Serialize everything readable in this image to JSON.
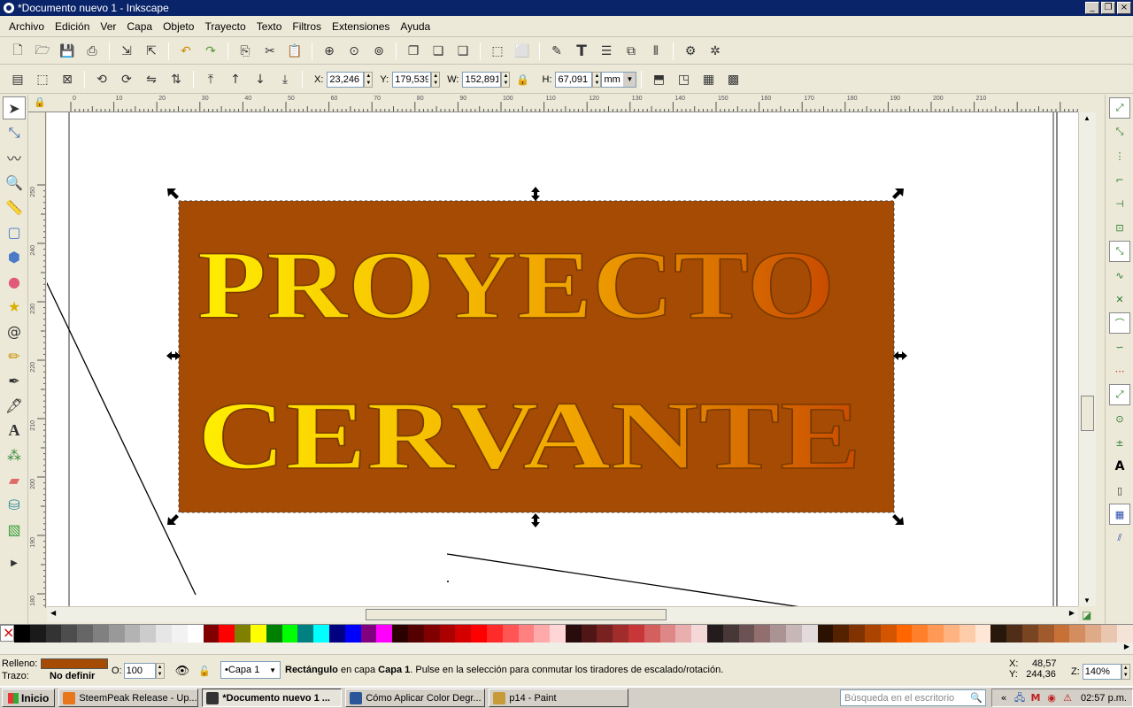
{
  "window": {
    "title": "*Documento nuevo 1 - Inkscape",
    "btn_min": "_",
    "btn_max": "❐",
    "btn_close": "×"
  },
  "menu": [
    "Archivo",
    "Edición",
    "Ver",
    "Capa",
    "Objeto",
    "Trayecto",
    "Texto",
    "Filtros",
    "Extensiones",
    "Ayuda"
  ],
  "toolbar1": [
    "new-icon",
    "open-icon",
    "save-icon",
    "print-icon",
    "import-icon",
    "export-icon",
    "undo-icon",
    "redo-icon",
    "copy-icon",
    "cut-icon",
    "paste-icon",
    "zoom-selection-icon",
    "zoom-drawing-icon",
    "zoom-page-icon",
    "duplicate-icon",
    "clone-icon",
    "unlink-clone-icon",
    "group-icon",
    "ungroup-icon",
    "fill-stroke-icon",
    "text-font-icon",
    "layers-icon",
    "xml-editor-icon",
    "align-icon",
    "preferences-icon",
    "document-properties-icon"
  ],
  "transform": {
    "x_label": "X:",
    "x_value": "23,246",
    "y_label": "Y:",
    "y_value": "179,539",
    "w_label": "W:",
    "w_value": "152,891",
    "h_label": "H:",
    "h_value": "67,091",
    "unit": "mm"
  },
  "ruler": {
    "top_labels": [
      "0",
      "10",
      "20",
      "30",
      "40",
      "50",
      "60",
      "70",
      "80",
      "90",
      "100",
      "110",
      "120",
      "130",
      "140",
      "150",
      "160",
      "170",
      "180",
      "190",
      "200",
      "210"
    ],
    "left_labels": [
      "250",
      "240",
      "230",
      "220",
      "210",
      "200",
      "190",
      "180"
    ]
  },
  "artwork": {
    "line1": "PROYECTO",
    "line2": "CERVANTE",
    "rect_color": "#a64b04",
    "text_gradient_start": "#ffef00",
    "text_gradient_end": "#c84a00"
  },
  "tools": [
    "selector-icon",
    "node-icon",
    "tweak-icon",
    "zoom-icon",
    "measure-icon",
    "rectangle-icon",
    "3d-box-icon",
    "ellipse-icon",
    "star-icon",
    "spiral-icon",
    "pencil-icon",
    "pen-icon",
    "calligraphy-icon",
    "text-icon",
    "spray-icon",
    "eraser-icon",
    "paint-bucket-icon",
    "gradient-icon"
  ],
  "snap_tools": [
    "snap-toggle-icon",
    "snap-bbox-icon",
    "snap-bbox-edge-icon",
    "snap-bbox-corner-icon",
    "snap-bbox-midpoint-icon",
    "snap-bbox-center-icon",
    "snap-nodes-icon",
    "snap-path-icon",
    "snap-intersection-icon",
    "snap-cusp-icon",
    "snap-smooth-icon",
    "snap-midpoint-icon",
    "snap-object-center-icon",
    "snap-rotation-center-icon",
    "snap-baseline-icon",
    "snap-page-border-icon",
    "snap-grid-icon",
    "snap-guide-icon"
  ],
  "palette": [
    "#000000",
    "#1a1a1a",
    "#333333",
    "#4d4d4d",
    "#666666",
    "#808080",
    "#999999",
    "#b3b3b3",
    "#cccccc",
    "#e6e6e6",
    "#f2f2f2",
    "#ffffff",
    "#800000",
    "#ff0000",
    "#808000",
    "#ffff00",
    "#008000",
    "#00ff00",
    "#008080",
    "#00ffff",
    "#000080",
    "#0000ff",
    "#800080",
    "#ff00ff",
    "#2b0000",
    "#550000",
    "#800000",
    "#aa0000",
    "#d40000",
    "#ff0000",
    "#ff2a2a",
    "#ff5555",
    "#ff8080",
    "#ffaaaa",
    "#ffd5d5",
    "#280b0b",
    "#501616",
    "#782121",
    "#a02c2c",
    "#c83737",
    "#d35f5f",
    "#de8787",
    "#e9afaf",
    "#f4d7d7",
    "#241c1c",
    "#483737",
    "#6c5353",
    "#916f6f",
    "#ac9393",
    "#c8b7b7",
    "#e3dbdb",
    "#2b1100",
    "#552200",
    "#803300",
    "#aa4400",
    "#d45500",
    "#ff6600",
    "#ff7f2a",
    "#ff9955",
    "#ffb380",
    "#ffccaa",
    "#ffe6d5",
    "#28170b",
    "#502d16",
    "#784421",
    "#a05a2c",
    "#c87137",
    "#d38d5f",
    "#deaa87",
    "#e9c6af",
    "#f4e3d7"
  ],
  "status": {
    "fill_label": "Relleno:",
    "fill_color": "#a64b04",
    "stroke_label": "Trazo:",
    "stroke_value": "No definir",
    "opacity_label": "O:",
    "opacity_value": "100",
    "layer": "•Capa 1",
    "msg_bold1": "Rectángulo",
    "msg_part1": " en capa ",
    "msg_bold2": "Capa 1",
    "msg_part2": ". Pulse en la selección para conmutar los tiradores de escalado/rotación.",
    "x_label": "X:",
    "x_coord": "48,57",
    "y_label": "Y:",
    "y_coord": "244,36",
    "zoom_label": "Z:",
    "zoom_value": "140%"
  },
  "taskbar": {
    "start": "Inicio",
    "tasks": [
      {
        "label": "SteemPeak Release - Up...",
        "icon_color": "#e8761b"
      },
      {
        "label": "*Documento nuevo 1 ...",
        "icon_color": "#333333"
      },
      {
        "label": "Cómo Aplicar Color Degr...",
        "icon_color": "#2b579a"
      },
      {
        "label": "p14 - Paint",
        "icon_color": "#c79b3a"
      }
    ],
    "search_placeholder": "Búsqueda en el escritorio",
    "tray_expand": "«",
    "clock": "02:57 p.m."
  }
}
